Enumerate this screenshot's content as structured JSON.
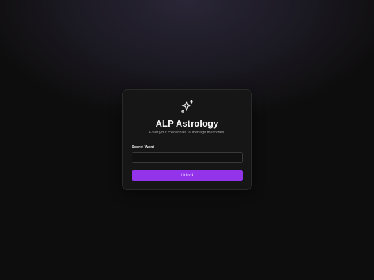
{
  "login": {
    "logo_icon": "sparkles-icon",
    "title": "ALP Astrology",
    "subtitle": "Enter your credentials to manage the fomes.",
    "secret_label": "Secret Word",
    "secret_value": "",
    "secret_placeholder": "",
    "unlock_label": "Unlock"
  },
  "colors": {
    "accent": "#9333ea",
    "card_background": "#171616",
    "page_background": "#0e0d0d"
  }
}
